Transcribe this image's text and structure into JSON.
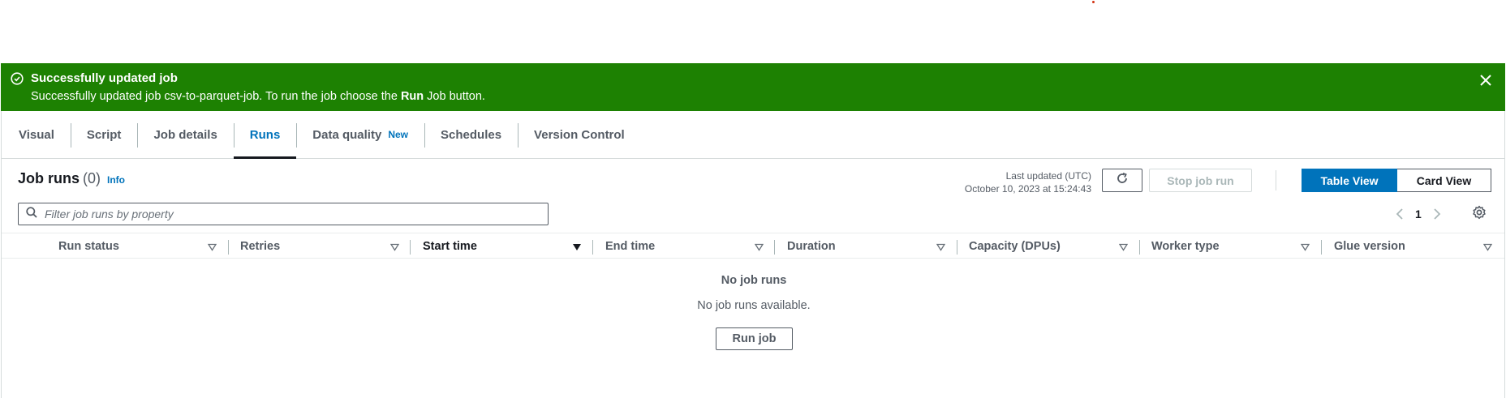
{
  "flash": {
    "title": "Successfully updated job",
    "message_prefix": "Successfully updated job csv-to-parquet-job. To run the job choose the ",
    "message_bold": "Run",
    "message_suffix": " Job button.",
    "color": "#1d8102"
  },
  "tabs": [
    {
      "label": "Visual"
    },
    {
      "label": "Script"
    },
    {
      "label": "Job details"
    },
    {
      "label": "Runs",
      "active": true
    },
    {
      "label": "Data quality",
      "badge": "New"
    },
    {
      "label": "Schedules"
    },
    {
      "label": "Version Control"
    }
  ],
  "runs": {
    "title": "Job runs",
    "count": "(0)",
    "info_link": "Info",
    "last_updated_label": "Last updated (UTC)",
    "last_updated_value": "October 10, 2023 at 15:24:43",
    "stop_button": "Stop job run",
    "view_table": "Table View",
    "view_card": "Card View",
    "filter_placeholder": "Filter job runs by property",
    "page": "1"
  },
  "table": {
    "columns": [
      {
        "label": "Run status"
      },
      {
        "label": "Retries"
      },
      {
        "label": "Start time",
        "sorted": true
      },
      {
        "label": "End time"
      },
      {
        "label": "Duration"
      },
      {
        "label": "Capacity (DPUs)"
      },
      {
        "label": "Worker type"
      },
      {
        "label": "Glue version"
      }
    ]
  },
  "empty": {
    "title": "No job runs",
    "message": "No job runs available.",
    "button": "Run job"
  },
  "colors": {
    "accent": "#0073bb",
    "success": "#1d8102"
  }
}
